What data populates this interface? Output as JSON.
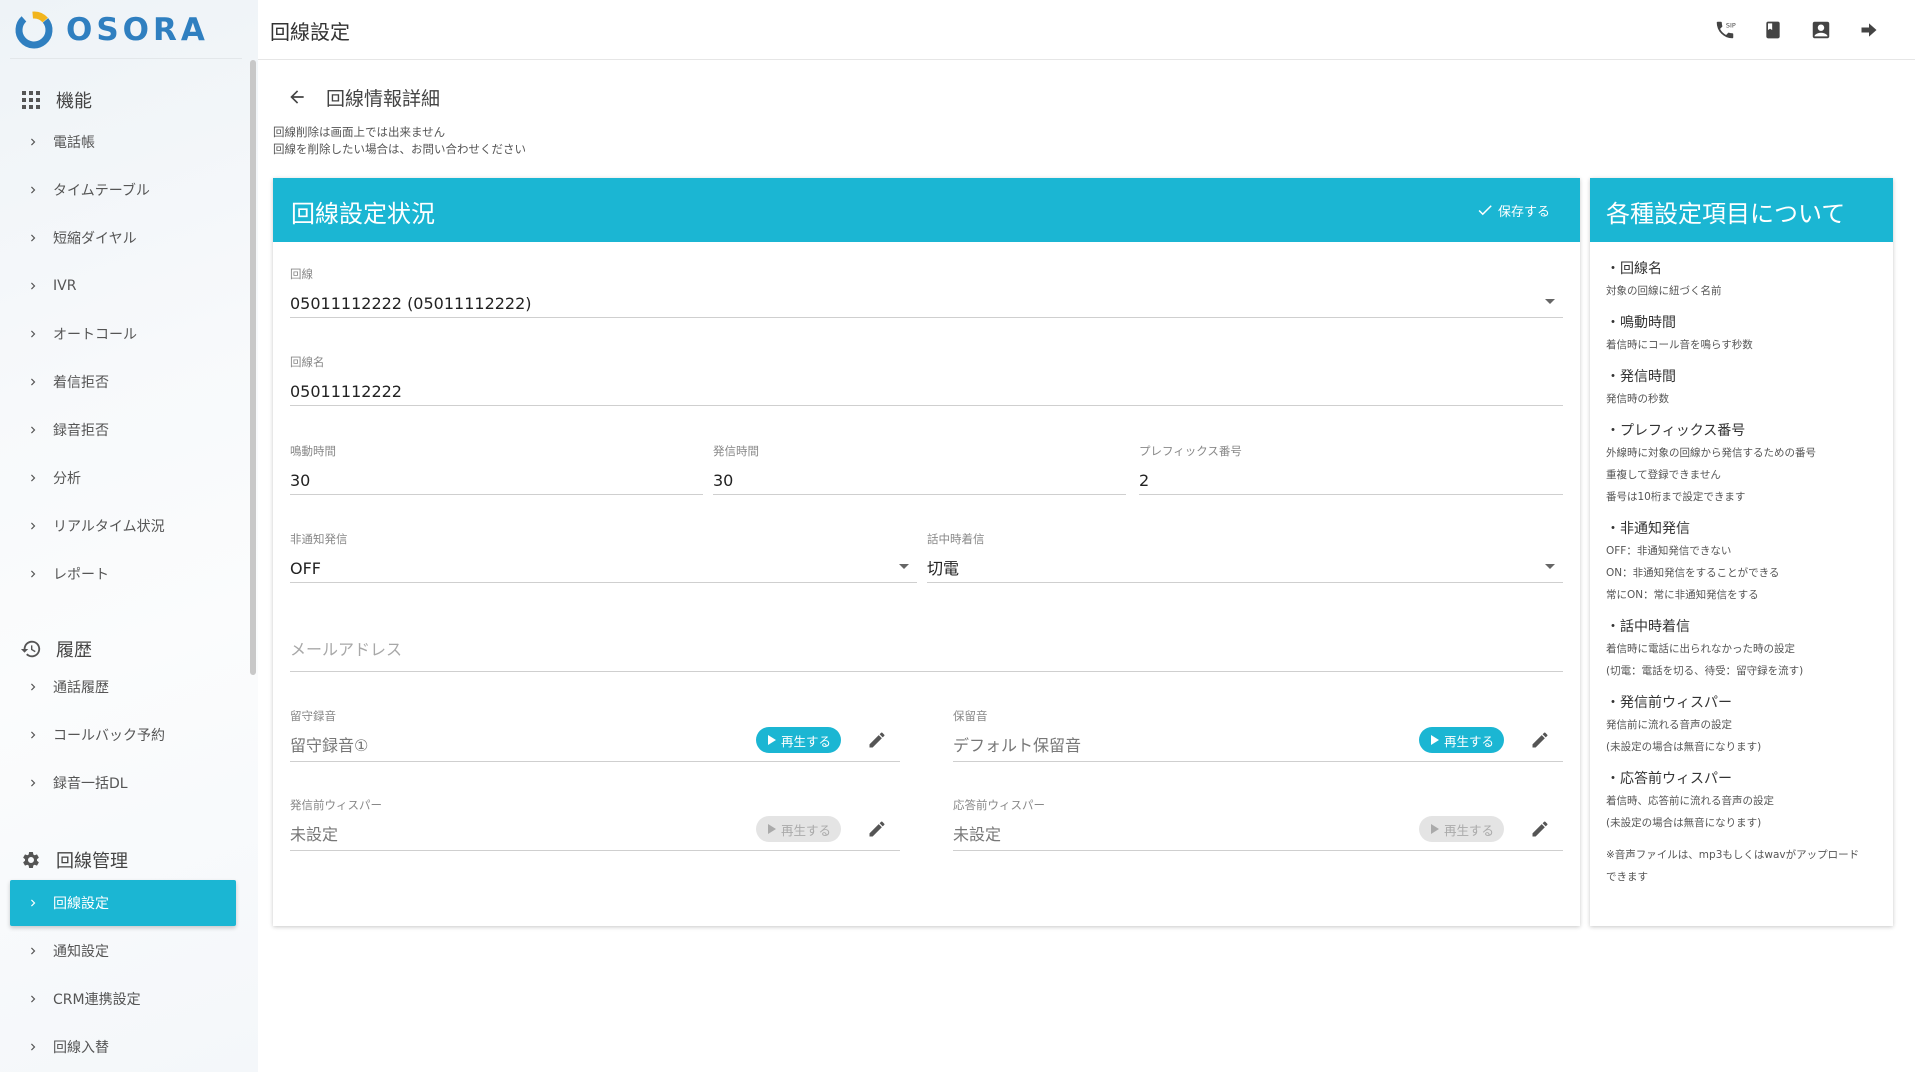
{
  "brand": {
    "name": "OSORA"
  },
  "topbar": {
    "title": "回線設定"
  },
  "page": {
    "title": "回線情報詳細",
    "notice_line1": "回線削除は画面上では出来ません",
    "notice_line2": "回線を削除したい場合は、お問い合わせください"
  },
  "sidebar": {
    "sections": {
      "features": "機能",
      "history": "履歴",
      "line_mgmt": "回線管理"
    },
    "features_items": [
      "電話帳",
      "タイムテーブル",
      "短縮ダイヤル",
      "IVR",
      "オートコール",
      "着信拒否",
      "録音拒否",
      "分析",
      "リアルタイム状況",
      "レポート"
    ],
    "history_items": [
      "通話履歴",
      "コールバック予約",
      "録音一括DL"
    ],
    "line_items": [
      "回線設定",
      "通知設定",
      "CRM連携設定",
      "回線入替"
    ]
  },
  "main": {
    "header": "回線設定状況",
    "save_label": "保存する",
    "line": {
      "label": "回線",
      "value": "05011112222 (05011112222)"
    },
    "line_name": {
      "label": "回線名",
      "value": "05011112222"
    },
    "ring_time": {
      "label": "鳴動時間",
      "value": "30"
    },
    "call_time": {
      "label": "発信時間",
      "value": "30"
    },
    "prefix": {
      "label": "プレフィックス番号",
      "value": "2"
    },
    "anonymous": {
      "label": "非通知発信",
      "value": "OFF"
    },
    "busy": {
      "label": "話中時着信",
      "value": "切電"
    },
    "email": {
      "placeholder": "メールアドレス"
    },
    "voicemail": {
      "label": "留守録音",
      "value": "留守録音①",
      "play": "再生する"
    },
    "hold": {
      "label": "保留音",
      "value": "デフォルト保留音",
      "play": "再生する"
    },
    "pre_whisper": {
      "label": "発信前ウィスパー",
      "value": "未設定",
      "play": "再生する"
    },
    "answer_whisper": {
      "label": "応答前ウィスパー",
      "value": "未設定",
      "play": "再生する"
    }
  },
  "side": {
    "header": "各種設定項目について",
    "items": [
      {
        "title": "・回線名",
        "lines": [
          "対象の回線に紐づく名前"
        ]
      },
      {
        "title": "・鳴動時間",
        "lines": [
          "着信時にコール音を鳴らす秒数"
        ]
      },
      {
        "title": "・発信時間",
        "lines": [
          "発信時の秒数"
        ]
      },
      {
        "title": "・プレフィックス番号",
        "lines": [
          "外線時に対象の回線から発信するための番号",
          "重複して登録できません",
          "番号は10桁まで設定できます"
        ]
      },
      {
        "title": "・非通知発信",
        "lines": [
          "OFF：非通知発信できない",
          "ON：非通知発信をすることができる",
          "常にON：常に非通知発信をする"
        ]
      },
      {
        "title": "・話中時着信",
        "lines": [
          "着信時に電話に出られなかった時の設定",
          "(切電：電話を切る、待受：留守録を流す)"
        ]
      },
      {
        "title": "・発信前ウィスパー",
        "lines": [
          "発信前に流れる音声の設定",
          "(未設定の場合は無音になります)"
        ]
      },
      {
        "title": "・応答前ウィスパー",
        "lines": [
          "着信時、応答前に流れる音声の設定",
          "(未設定の場合は無音になります)"
        ]
      },
      {
        "title": "",
        "lines": [
          "※音声ファイルは、mp3もしくはwavがアップロード",
          "できます"
        ]
      }
    ]
  },
  "colors": {
    "accent": "#1bb6d3",
    "brand": "#2f7fc0"
  },
  "icons": [
    "sip-phone-icon",
    "book-icon",
    "contact-icon",
    "logout-arrow-icon",
    "grid-icon",
    "history-icon",
    "gear-icon",
    "chevron-right-icon",
    "back-arrow-icon",
    "check-icon",
    "pencil-icon",
    "play-icon"
  ]
}
